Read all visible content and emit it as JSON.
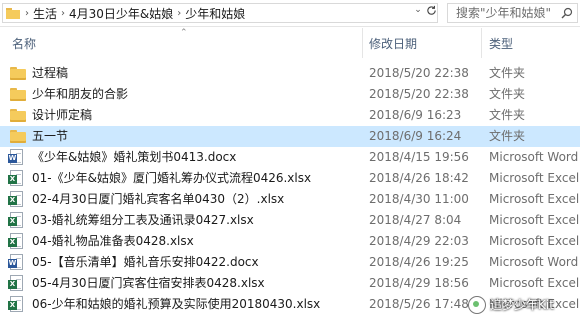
{
  "address_bar": {
    "path": [
      "生活",
      "4月30日少年&姑娘",
      "少年和姑娘"
    ],
    "search_placeholder": "搜索\"少年和姑娘\""
  },
  "columns": {
    "name": "名称",
    "date": "修改日期",
    "type": "类型"
  },
  "files": [
    {
      "name": "过程稿",
      "date": "2018/5/20 22:38",
      "type": "文件夹",
      "kind": "folder",
      "selected": false
    },
    {
      "name": "少年和朋友的合影",
      "date": "2018/5/20 22:38",
      "type": "文件夹",
      "kind": "folder",
      "selected": false
    },
    {
      "name": "设计师定稿",
      "date": "2018/6/9 16:23",
      "type": "文件夹",
      "kind": "folder",
      "selected": false
    },
    {
      "name": "五一节",
      "date": "2018/6/9 16:24",
      "type": "文件夹",
      "kind": "folder",
      "selected": true
    },
    {
      "name": "《少年&姑娘》婚礼策划书0413.docx",
      "date": "2018/4/15 19:56",
      "type": "Microsoft Word",
      "kind": "word",
      "selected": false
    },
    {
      "name": "01-《少年&姑娘》厦门婚礼筹办仪式流程0426.xlsx",
      "date": "2018/4/26 18:42",
      "type": "Microsoft Excel",
      "kind": "excel",
      "selected": false
    },
    {
      "name": "02-4月30日厦门婚礼宾客名单0430（2）.xlsx",
      "date": "2018/4/30 11:00",
      "type": "Microsoft Excel",
      "kind": "excel",
      "selected": false
    },
    {
      "name": "03-婚礼统筹组分工表及通讯录0427.xlsx",
      "date": "2018/4/27 8:04",
      "type": "Microsoft Excel",
      "kind": "excel",
      "selected": false
    },
    {
      "name": "04-婚礼物品准备表0428.xlsx",
      "date": "2018/4/29 22:03",
      "type": "Microsoft Excel",
      "kind": "excel",
      "selected": false
    },
    {
      "name": "05-【音乐清单】婚礼音乐安排0422.docx",
      "date": "2018/4/26 19:25",
      "type": "Microsoft Word",
      "kind": "word",
      "selected": false
    },
    {
      "name": "05-4月30日厦门宾客住宿安排表0428.xlsx",
      "date": "2018/4/29 18:56",
      "type": "Microsoft Excel",
      "kind": "excel",
      "selected": false
    },
    {
      "name": "06-少年和姑娘的婚礼预算及实际使用20180430.xlsx",
      "date": "2018/5/26 17:48",
      "type": "Microsoft Excel",
      "kind": "excel",
      "selected": false
    }
  ],
  "watermark": "追梦少年Kit",
  "colors": {
    "selected_row": "#cce8ff",
    "header_text": "#4c607a",
    "folder": "#f5cb5c"
  }
}
